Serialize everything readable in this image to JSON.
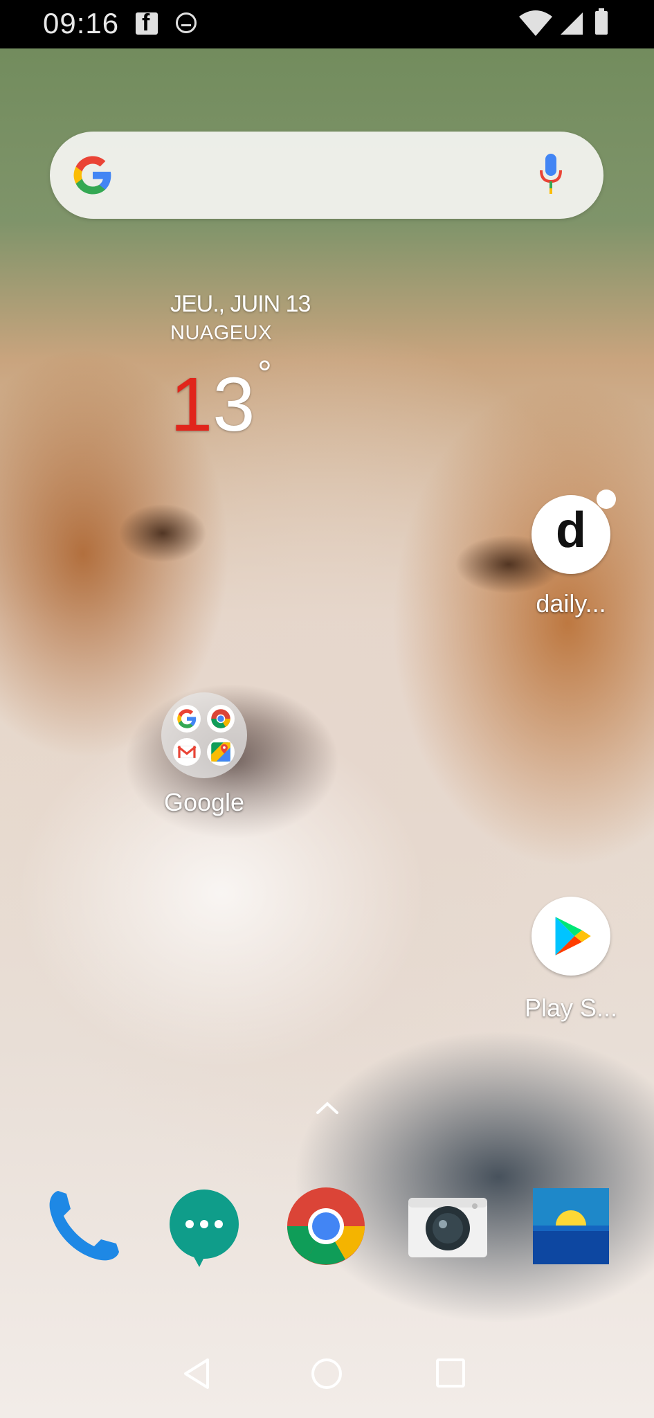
{
  "status_bar": {
    "time": "09:16",
    "icons": [
      "facebook-icon",
      "messenger-icon",
      "wifi-icon",
      "signal-icon",
      "battery-icon"
    ]
  },
  "search_widget": {
    "logo": "google-g-icon",
    "mic": "mic-icon"
  },
  "weather_widget": {
    "date": "JEU., JUIN 13",
    "condition": "NUAGEUX",
    "temp_first_digit": "1",
    "temp_rest": "3",
    "degree": "°",
    "temp_first_color": "#e1251b"
  },
  "home_apps": [
    {
      "label": "daily...",
      "icon": "dailymotion-icon"
    },
    {
      "label": "Google",
      "icon": "google-folder-icon",
      "folder_apps": [
        "google-icon",
        "chrome-icon",
        "gmail-icon",
        "maps-icon"
      ]
    },
    {
      "label": "Play S...",
      "icon": "play-store-icon"
    }
  ],
  "dock": [
    {
      "icon": "phone-icon"
    },
    {
      "icon": "messages-icon"
    },
    {
      "icon": "chrome-icon"
    },
    {
      "icon": "camera-icon"
    },
    {
      "icon": "weather-icon"
    }
  ],
  "nav_bar": [
    "back-icon",
    "home-icon",
    "recents-icon"
  ]
}
